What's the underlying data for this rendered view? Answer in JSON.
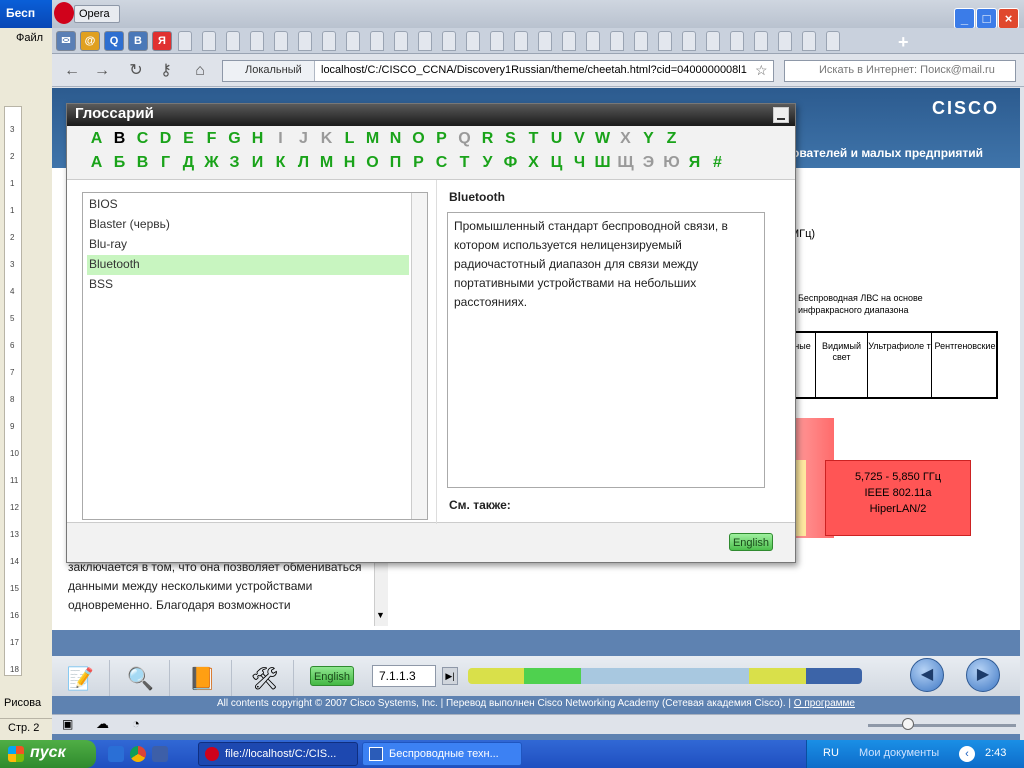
{
  "word": {
    "title": "Бесп",
    "menu_file": "Файл",
    "draw_label": "Рисова",
    "status_page": "Стр. 2",
    "ruler_numbers": [
      "3",
      "2",
      "1",
      "1",
      "2",
      "3",
      "4",
      "5",
      "6",
      "7",
      "8",
      "9",
      "10",
      "11",
      "12",
      "13",
      "14",
      "15",
      "16",
      "17",
      "18"
    ]
  },
  "opera": {
    "menu_label": "Opera",
    "address": {
      "local_label": "Локальный",
      "url": "localhost/C:/CISCO_CCNA/Discovery1Russian/theme/cheetah.html?cid=0400000008l1"
    },
    "search_placeholder": "Искать в Интернет: Поиск@mail.ru"
  },
  "page": {
    "subtitle": "ователей и малых предприятий",
    "cisco_logo": "CISCO",
    "left_text": "заключается в том, что она позволяет обмениваться данными между несколькими устройствами одновременно. Благодаря возможности",
    "spec_label1": "МГц)",
    "spec_label2": "Беспроводная ЛВС на основе инфракрасного диапазона",
    "spectrum_cells": [
      "ные",
      "Видимый свет",
      "Ультрафиоле т",
      "Рентгеновские"
    ],
    "red_block": [
      "5,725 - 5,850 ГГц",
      "IEEE 802.11a",
      "HiperLAN/2"
    ]
  },
  "glossary": {
    "title": "Глоссарий",
    "latin_letters": [
      "A",
      "B",
      "C",
      "D",
      "E",
      "F",
      "G",
      "H",
      "I",
      "J",
      "K",
      "L",
      "M",
      "N",
      "O",
      "P",
      "Q",
      "R",
      "S",
      "T",
      "U",
      "V",
      "W",
      "X",
      "Y",
      "Z"
    ],
    "latin_disabled": [
      "I",
      "J",
      "K",
      "Q",
      "X"
    ],
    "latin_active": "B",
    "cyrillic_letters": [
      "А",
      "Б",
      "В",
      "Г",
      "Д",
      "Ж",
      "З",
      "И",
      "К",
      "Л",
      "М",
      "Н",
      "О",
      "П",
      "Р",
      "С",
      "Т",
      "У",
      "Ф",
      "Х",
      "Ц",
      "Ч",
      "Ш",
      "Щ",
      "Э",
      "Ю",
      "Я",
      "#"
    ],
    "cyrillic_disabled": [
      "Щ",
      "Э",
      "Ю"
    ],
    "terms": [
      "BIOS",
      "Blaster (червь)",
      "Blu-ray",
      "Bluetooth",
      "BSS"
    ],
    "selected_term": "Bluetooth",
    "definition": "Промышленный стандарт беспроводной связи, в котором используется нелицензируемый радиочастотный диапазон для связи между портативными устройствами на небольших расстояниях.",
    "see_also_label": "См. также:",
    "english_button": "English"
  },
  "course": {
    "english_button": "English",
    "page_number": "7.1.1.3",
    "progress_colors": [
      "#d9e04a",
      "#4fd14f",
      "#a8c8e0",
      "#a8c8e0",
      "#a8c8e0",
      "#d9e04a",
      "#3c64a8"
    ],
    "footer": "All contents copyright © 2007 Cisco Systems, Inc. | Перевод выполнен Cisco Networking Academy (Сетевая академия Cisco). |",
    "footer_link": "О программе"
  },
  "taskbar": {
    "start_label": "пуск",
    "tasks": [
      "file://localhost/C:/CIS...",
      "Беспроводные техн..."
    ],
    "lang": "RU",
    "folder": "Мои документы",
    "time": "2:43"
  }
}
